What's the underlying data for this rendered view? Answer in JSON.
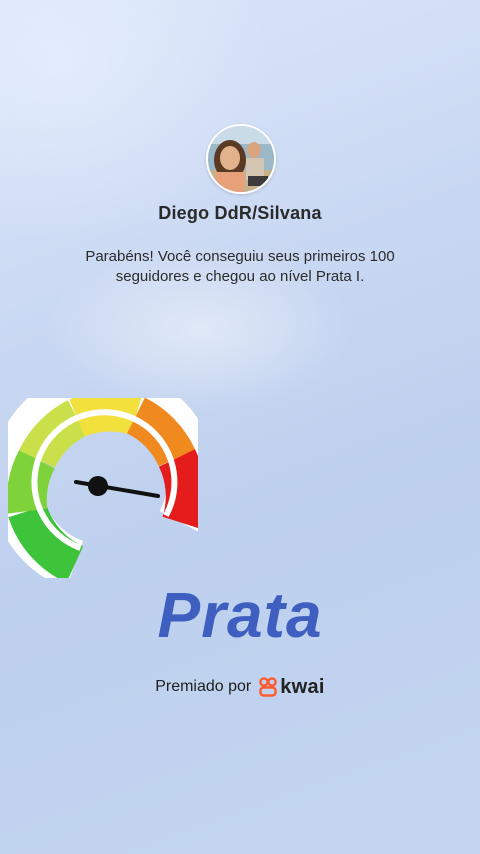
{
  "profile": {
    "username": "Diego DdR/Silvana",
    "avatar_icon": "profile-photo"
  },
  "message": "Parabéns! Você conseguiu seus primeiros 100 seguidores e chegou ao nível Prata I.",
  "gauge": {
    "icon": "speedometer-gauge-icon",
    "segment_colors": [
      "#3ec43a",
      "#8fd63a",
      "#d7e447",
      "#f0e23c",
      "#f28a1e",
      "#e51c1c"
    ]
  },
  "level": {
    "title": "Prata",
    "color": "#3f5fc0"
  },
  "footer": {
    "awarded_by": "Premiado por",
    "brand": "kwai",
    "brand_icon": "kwai-logo-icon",
    "brand_color": "#ff5a2e"
  }
}
